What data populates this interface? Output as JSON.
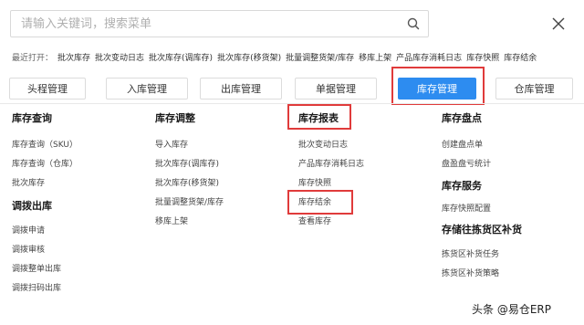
{
  "search": {
    "placeholder": "请输入关键词，搜索菜单"
  },
  "recent": {
    "label": "最近打开：",
    "items": [
      "批次库存",
      "批次变动日志",
      "批次库存(调库存)",
      "批次库存(移货架)",
      "批量调整货架/库存",
      "移库上架",
      "产品库存消耗日志",
      "库存快照",
      "库存结余"
    ]
  },
  "tabs": [
    "头程管理",
    "入库管理",
    "出库管理",
    "单据管理",
    "库存管理",
    "仓库管理"
  ],
  "active_tab": "库存管理",
  "colors": {
    "accent": "#2d8cf0",
    "highlight": "#e03b3b"
  },
  "columns": {
    "c1": {
      "heading1": "库存查询",
      "items1": [
        "库存查询（SKU）",
        "库存查询（仓库）",
        "批次库存"
      ],
      "heading2": "调拨出库",
      "items2": [
        "调拨申请",
        "调拨审核",
        "调拨整单出库",
        "调拨扫码出库"
      ]
    },
    "c2": {
      "heading1": "库存调整",
      "items1": [
        "导入库存",
        "批次库存(调库存)",
        "批次库存(移货架)",
        "批量调整货架/库存",
        "移库上架"
      ]
    },
    "c3": {
      "heading1": "库存报表",
      "items1": [
        "批次变动日志",
        "产品库存消耗日志",
        "库存快照",
        "库存结余",
        "查看库存"
      ]
    },
    "c4": {
      "heading1": "库存盘点",
      "items1": [
        "创建盘点单",
        "盘盈盘亏统计"
      ],
      "heading2": "库存服务",
      "items2": [
        "库存快照配置"
      ],
      "heading3": "存储往拣货区补货",
      "items3": [
        "拣货区补货任务",
        "拣货区补货策略"
      ]
    }
  },
  "watermark": "头条 @易仓ERP"
}
